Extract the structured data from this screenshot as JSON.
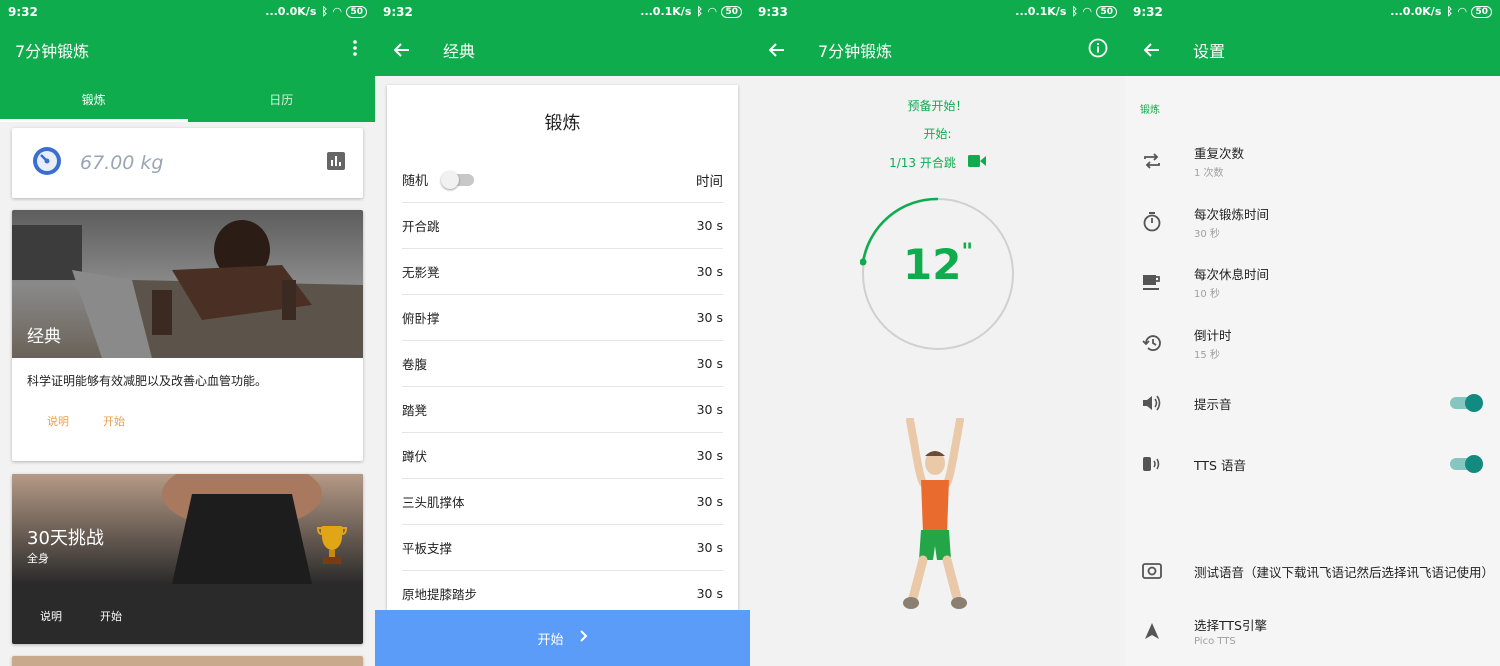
{
  "statusbars": [
    {
      "time": "9:32",
      "speed": "...0.0K/s",
      "battery": "50"
    },
    {
      "time": "9:32",
      "speed": "...0.1K/s",
      "battery": "50"
    },
    {
      "time": "9:33",
      "speed": "...0.1K/s",
      "battery": "50"
    },
    {
      "time": "9:32",
      "speed": "...0.0K/s",
      "battery": "50"
    }
  ],
  "screen1": {
    "title": "7分钟锻炼",
    "tabs": [
      "锻炼",
      "日历"
    ],
    "weight": "67.00 kg",
    "classic": {
      "title": "经典",
      "desc": "科学证明能够有效减肥以及改善心血管功能。",
      "info": "说明",
      "start": "开始"
    },
    "challenge": {
      "title": "30天挑战",
      "subtitle": "全身",
      "info": "说明",
      "start": "开始"
    }
  },
  "screen2": {
    "title": "经典",
    "card_title": "锻炼",
    "random_label": "随机",
    "time_header": "时间",
    "exercises": [
      {
        "name": "开合跳",
        "time": "30 s"
      },
      {
        "name": "无影凳",
        "time": "30 s"
      },
      {
        "name": "俯卧撑",
        "time": "30 s"
      },
      {
        "name": "卷腹",
        "time": "30 s"
      },
      {
        "name": "踏凳",
        "time": "30 s"
      },
      {
        "name": "蹲伏",
        "time": "30 s"
      },
      {
        "name": "三头肌撑体",
        "time": "30 s"
      },
      {
        "name": "平板支撑",
        "time": "30 s"
      },
      {
        "name": "原地提膝踏步",
        "time": "30 s"
      }
    ],
    "start_label": "开始"
  },
  "screen3": {
    "title": "7分钟锻炼",
    "ready": "预备开始！",
    "start": "开始:",
    "progress": "1/13 开合跳",
    "countdown": "12",
    "countdown_unit": "\""
  },
  "screen4": {
    "title": "设置",
    "section": "锻炼",
    "settings": [
      {
        "main": "重复次数",
        "sub": "1 次数",
        "icon": "repeat-icon"
      },
      {
        "main": "每次锻炼时间",
        "sub": "30 秒",
        "icon": "stopwatch-icon"
      },
      {
        "main": "每次休息时间",
        "sub": "10 秒",
        "icon": "coffee-icon"
      },
      {
        "main": "倒计时",
        "sub": "15 秒",
        "icon": "history-icon"
      },
      {
        "main": "提示音",
        "sub": "",
        "icon": "volume-icon"
      },
      {
        "main": "TTS 语音",
        "sub": "",
        "icon": "speech-icon"
      },
      {
        "main": "测试语音（建议下载讯飞语记然后选择讯飞语记使用）",
        "sub": "",
        "icon": "test-voice-icon"
      },
      {
        "main": "选择TTS引擎",
        "sub": "Pico TTS",
        "icon": "navigation-icon"
      }
    ],
    "accent": "#0fac4e",
    "toggle_color": "#128a80"
  }
}
